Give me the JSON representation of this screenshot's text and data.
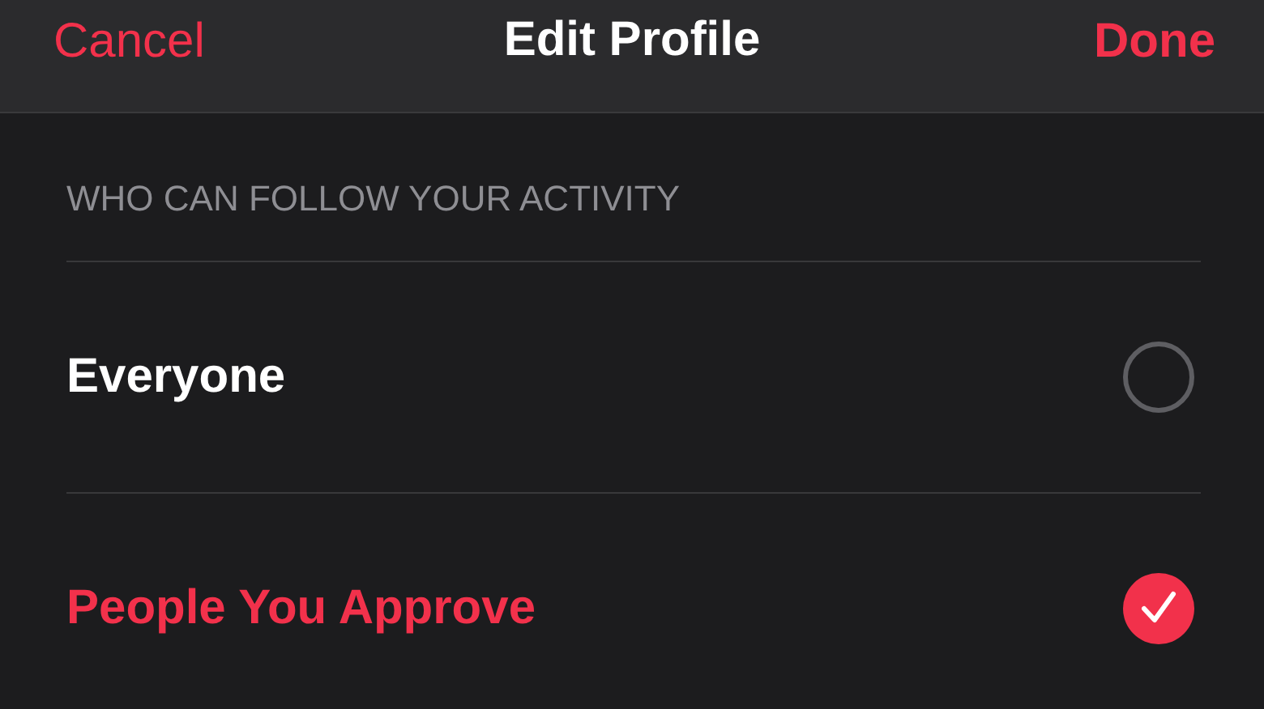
{
  "nav": {
    "cancel": "Cancel",
    "title": "Edit Profile",
    "done": "Done"
  },
  "section": {
    "header": "WHO CAN FOLLOW YOUR ACTIVITY",
    "options": [
      {
        "label": "Everyone",
        "selected": false
      },
      {
        "label": "People You Approve",
        "selected": true
      }
    ]
  }
}
